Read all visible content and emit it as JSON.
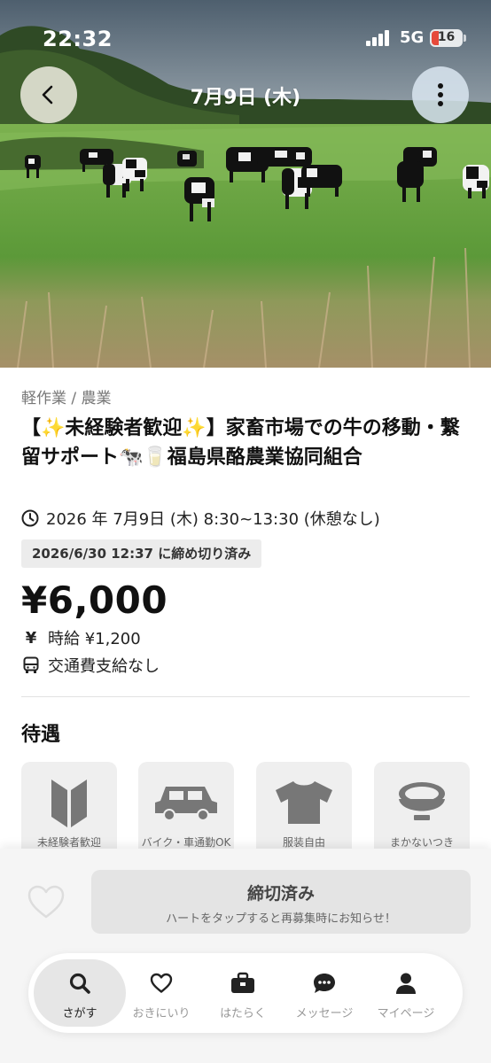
{
  "status_bar": {
    "time": "22:32",
    "network": "5G",
    "battery": "16"
  },
  "header": {
    "title": "7月9日 (木)"
  },
  "job": {
    "category": "軽作業 / 農業",
    "title": "【✨未経験者歓迎✨】家畜市場での牛の移動・繋留サポート🐄🥛福島県酪農業協同組合",
    "datetime": "2026 年 7月9日 (木) 8:30~13:30 (休憩なし)",
    "deadline_badge": "2026/6/30 12:37 に締め切り済み",
    "price": "¥6,000",
    "hourly_icon": "¥",
    "hourly": "時給 ¥1,200",
    "transport": "交通費支給なし"
  },
  "benefits_section": {
    "title": "待遇",
    "items": [
      {
        "label": "未経験者歓迎",
        "icon": "beginner-mark-icon"
      },
      {
        "label": "バイク・車通勤OK",
        "icon": "car-icon"
      },
      {
        "label": "服装自由",
        "icon": "tshirt-icon"
      },
      {
        "label": "まかないつき",
        "icon": "rice-bowl-icon"
      }
    ]
  },
  "action": {
    "button_label": "締切済み",
    "button_sub": "ハートをタップすると再募集時にお知らせ！"
  },
  "tabbar": {
    "tabs": [
      {
        "label": "さがす",
        "icon": "search-icon",
        "active": true
      },
      {
        "label": "おきにいり",
        "icon": "heart-icon",
        "active": false
      },
      {
        "label": "はたらく",
        "icon": "briefcase-icon",
        "active": false
      },
      {
        "label": "メッセージ",
        "icon": "chat-icon",
        "active": false
      },
      {
        "label": "マイページ",
        "icon": "person-icon",
        "active": false
      }
    ]
  },
  "colors": {
    "battery_low": "#e64a3b",
    "grass": "#5f9a3e",
    "sky": "#8d9aa6"
  }
}
